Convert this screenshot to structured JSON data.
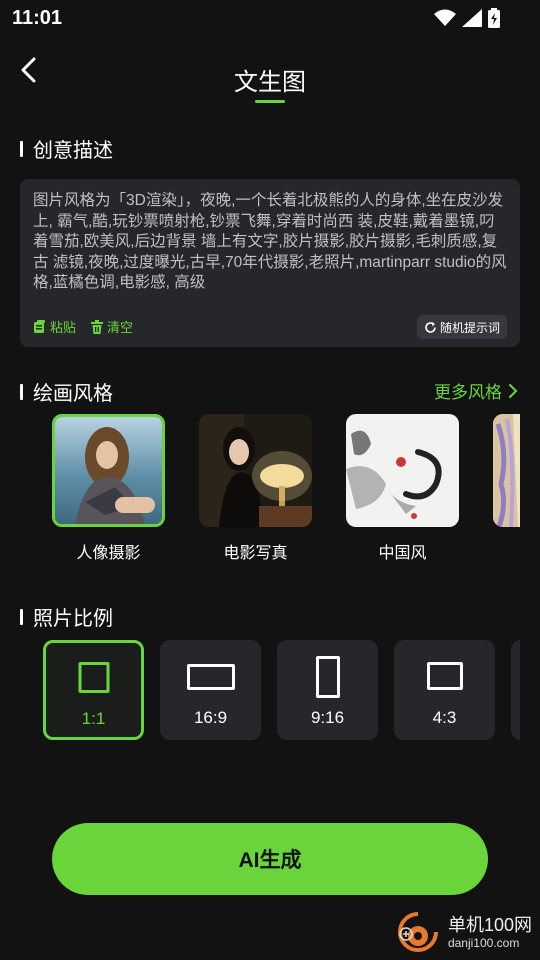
{
  "status": {
    "time": "11:01"
  },
  "header": {
    "title": "文生图"
  },
  "prompt_section": {
    "title": "创意描述",
    "text": "图片风格为「3D渲染」，夜晚,一个长着北极熊的人的身体,坐在皮沙发上, 霸气,酷,玩钞票喷射枪,钞票飞舞,穿着时尚西 装,皮鞋,戴着墨镜,叼着雪茄,欧美风,后边背景 墙上有文字,胶片摄影,胶片摄影,毛刺质感,复古 滤镜,夜晚,过度曝光,古早,70年代摄影,老照片,martinparr studio的风格,蓝橘色调,电影感, 高级",
    "paste_label": "粘贴",
    "clear_label": "清空",
    "random_label": "随机提示词"
  },
  "style_section": {
    "title": "绘画风格",
    "more_label": "更多风格",
    "items": [
      {
        "label": "人像摄影"
      },
      {
        "label": "电影写真"
      },
      {
        "label": "中国风"
      }
    ]
  },
  "ratio_section": {
    "title": "照片比例",
    "items": [
      {
        "label": "1:1"
      },
      {
        "label": "16:9"
      },
      {
        "label": "9:16"
      },
      {
        "label": "4:3"
      }
    ]
  },
  "generate": {
    "label": "AI生成"
  },
  "watermark": {
    "name": "单机100网",
    "url": "danji100.com"
  },
  "colors": {
    "accent": "#6ad53a",
    "background": "#121212",
    "card": "#26272b"
  }
}
